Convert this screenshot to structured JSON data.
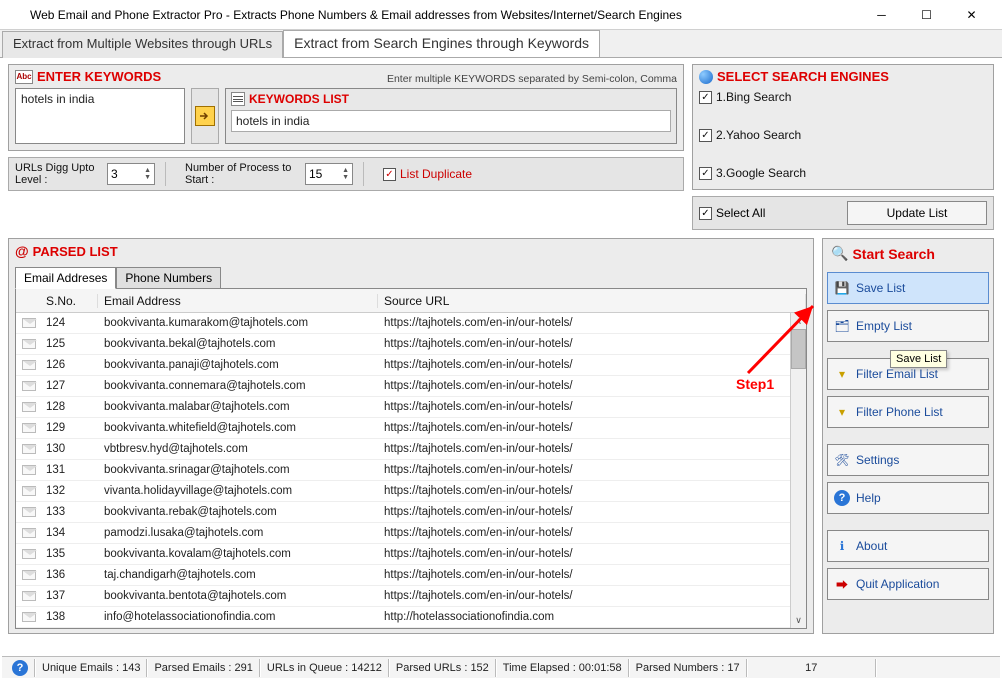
{
  "window": {
    "title": "Web Email and Phone Extractor Pro - Extracts Phone Numbers & Email addresses from Websites/Internet/Search Engines"
  },
  "maintabs": {
    "t1": "Extract from Multiple Websites through URLs",
    "t2": "Extract from Search Engines through Keywords"
  },
  "keywords": {
    "title": "ENTER KEYWORDS",
    "hint": "Enter multiple KEYWORDS separated by Semi-colon, Comma",
    "input": "hotels in india",
    "list_title": "KEYWORDS LIST",
    "list_item": "hotels in india"
  },
  "options": {
    "digg_label": "URLs Digg Upto Level :",
    "digg_value": "3",
    "proc_label": "Number of Process to Start :",
    "proc_value": "15",
    "dup_label": "List Duplicate"
  },
  "engines": {
    "title": "SELECT SEARCH ENGINES",
    "e1": "1.Bing Search",
    "e2": "2.Yahoo Search",
    "e3": "3.Google Search",
    "selectall": "Select All",
    "update": "Update List"
  },
  "parsed": {
    "title": "PARSED LIST",
    "tab1": "Email Addreses",
    "tab2": "Phone Numbers",
    "col_sno": "S.No.",
    "col_email": "Email Address",
    "col_src": "Source URL",
    "rows": [
      {
        "sno": "124",
        "email": "bookvivanta.kumarakom@tajhotels.com",
        "url": "https://tajhotels.com/en-in/our-hotels/"
      },
      {
        "sno": "125",
        "email": "bookvivanta.bekal@tajhotels.com",
        "url": "https://tajhotels.com/en-in/our-hotels/"
      },
      {
        "sno": "126",
        "email": "bookvivanta.panaji@tajhotels.com",
        "url": "https://tajhotels.com/en-in/our-hotels/"
      },
      {
        "sno": "127",
        "email": "bookvivanta.connemara@tajhotels.com",
        "url": "https://tajhotels.com/en-in/our-hotels/"
      },
      {
        "sno": "128",
        "email": "bookvivanta.malabar@tajhotels.com",
        "url": "https://tajhotels.com/en-in/our-hotels/"
      },
      {
        "sno": "129",
        "email": "bookvivanta.whitefield@tajhotels.com",
        "url": "https://tajhotels.com/en-in/our-hotels/"
      },
      {
        "sno": "130",
        "email": "vbtbresv.hyd@tajhotels.com",
        "url": "https://tajhotels.com/en-in/our-hotels/"
      },
      {
        "sno": "131",
        "email": "bookvivanta.srinagar@tajhotels.com",
        "url": "https://tajhotels.com/en-in/our-hotels/"
      },
      {
        "sno": "132",
        "email": "vivanta.holidayvillage@tajhotels.com",
        "url": "https://tajhotels.com/en-in/our-hotels/"
      },
      {
        "sno": "133",
        "email": "bookvivanta.rebak@tajhotels.com",
        "url": "https://tajhotels.com/en-in/our-hotels/"
      },
      {
        "sno": "134",
        "email": "pamodzi.lusaka@tajhotels.com",
        "url": "https://tajhotels.com/en-in/our-hotels/"
      },
      {
        "sno": "135",
        "email": "bookvivanta.kovalam@tajhotels.com",
        "url": "https://tajhotels.com/en-in/our-hotels/"
      },
      {
        "sno": "136",
        "email": "taj.chandigarh@tajhotels.com",
        "url": "https://tajhotels.com/en-in/our-hotels/"
      },
      {
        "sno": "137",
        "email": "bookvivanta.bentota@tajhotels.com",
        "url": "https://tajhotels.com/en-in/our-hotels/"
      },
      {
        "sno": "138",
        "email": "info@hotelassociationofindia.com",
        "url": "http://hotelassociationofindia.com"
      }
    ]
  },
  "actions": {
    "title": "Start Search",
    "save": "Save List",
    "empty": "Empty List",
    "filter_email": "Filter Email List",
    "filter_phone": "Filter Phone List",
    "settings": "Settings",
    "help": "Help",
    "about": "About",
    "quit": "Quit Application",
    "tooltip": "Save List"
  },
  "status": {
    "unique": "Unique Emails :  143",
    "parsed": "Parsed Emails :   291",
    "queue": "URLs in Queue :  14212",
    "purls": "Parsed URLs :  152",
    "time": "Time Elapsed :   00:01:58",
    "pnum": "Parsed Numbers :  17",
    "right": "17"
  },
  "annot": {
    "step": "Step1"
  }
}
